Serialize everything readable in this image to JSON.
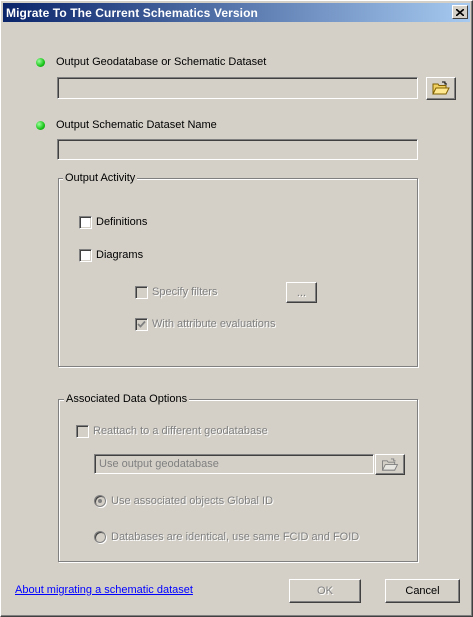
{
  "window": {
    "title": "Migrate To The Current Schematics Version"
  },
  "output_geodatabase": {
    "label": "Output Geodatabase or Schematic Dataset",
    "value": "",
    "browse_icon": "folder-open-icon"
  },
  "output_dataset_name": {
    "label": "Output Schematic Dataset Name",
    "value": ""
  },
  "output_activity": {
    "legend": "Output Activity",
    "definitions_label": "Definitions",
    "definitions_checked": false,
    "diagrams_label": "Diagrams",
    "diagrams_checked": false,
    "specify_filters_label": "Specify filters",
    "specify_filters_checked": false,
    "filters_button_label": "...",
    "attribute_eval_label": "With attribute evaluations",
    "attribute_eval_checked": true
  },
  "associated_data": {
    "legend": "Associated Data Options",
    "reattach_label": "Reattach to a different geodatabase",
    "reattach_checked": false,
    "geodatabase_value": "Use output geodatabase",
    "use_global_id_label": "Use associated objects Global ID",
    "use_global_id_selected": true,
    "identical_db_label": "Databases are identical, use same FCID and FOID",
    "identical_db_selected": false
  },
  "footer": {
    "help_link": "About migrating a schematic dataset",
    "ok_label": "OK",
    "cancel_label": "Cancel"
  },
  "colors": {
    "dialog_bg": "#d4d0c8",
    "title_start": "#0a246a",
    "title_end": "#a6caf0",
    "required_dot": "#19c419",
    "link": "#0000ff",
    "disabled_text": "#808080"
  }
}
